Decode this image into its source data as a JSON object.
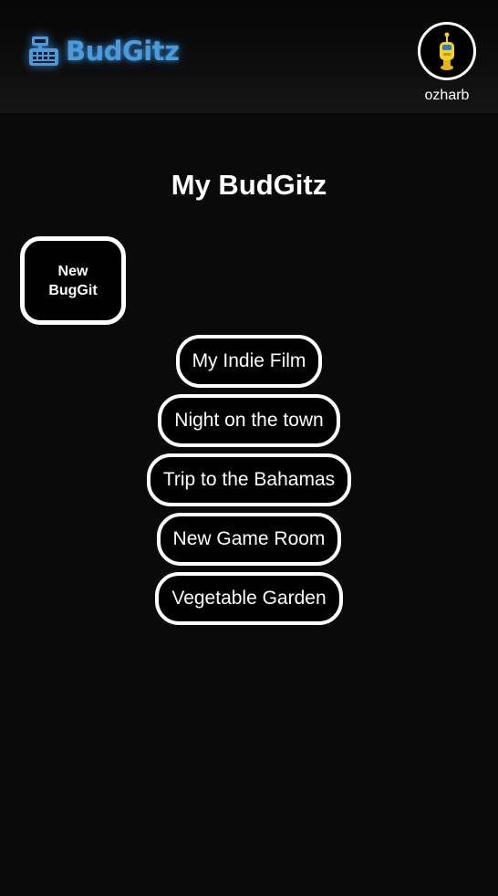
{
  "header": {
    "app_name": "BudGitz",
    "brand_color": "#4b9ad9",
    "brand_icon": "cash-register-icon",
    "avatar_icon": "robot-avatar-icon",
    "username": "ozharb"
  },
  "main": {
    "title": "My BudGitz",
    "new_button_label": "New BugGit",
    "budgets": [
      {
        "label": "My Indie Film"
      },
      {
        "label": "Night on the town"
      },
      {
        "label": "Trip to the Bahamas"
      },
      {
        "label": "New Game Room"
      },
      {
        "label": "Vegetable Garden"
      }
    ]
  }
}
